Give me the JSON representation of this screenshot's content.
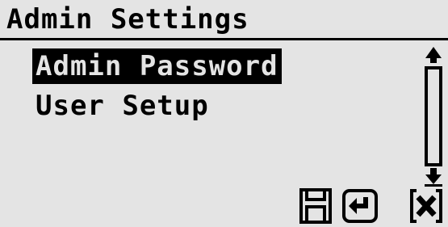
{
  "screen": {
    "title": "Admin Settings"
  },
  "menu": {
    "items": [
      {
        "label": "Admin Password",
        "selected": true
      },
      {
        "label": "User Setup",
        "selected": false
      }
    ]
  },
  "scrollbar": {
    "up_icon": "scroll-up-arrow-icon",
    "down_icon": "scroll-down-arrow-icon"
  },
  "softkeys": [
    {
      "icon": "save-icon"
    },
    {
      "icon": "enter-icon"
    },
    {
      "icon": "cancel-icon"
    }
  ],
  "colors": {
    "background": "#e4e4e4",
    "foreground": "#000000"
  }
}
